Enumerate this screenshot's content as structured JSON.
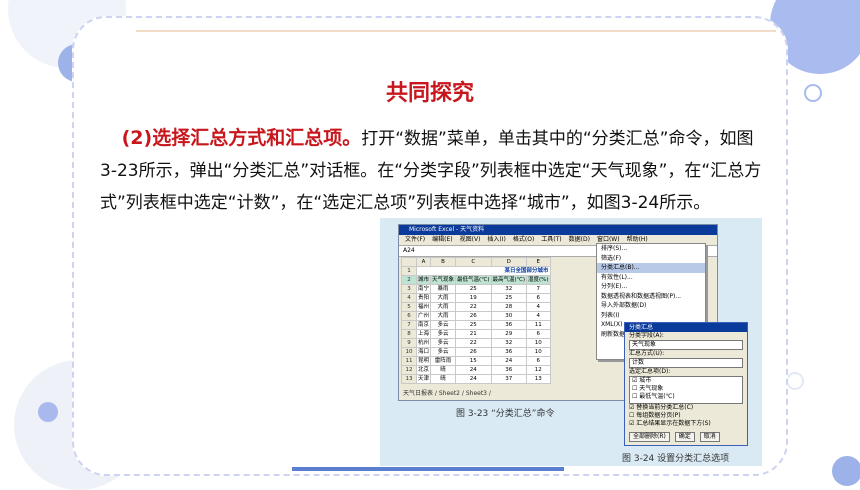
{
  "slide": {
    "title": "共同探究",
    "para_highlight": "(2)选择汇总方式和汇总项。",
    "para_text": "打开“数据”菜单，单击其中的“分类汇总”命令，如图3-23所示，弹出“分类汇总”对话框。在“分类字段”列表框中选定“天气现象”，在“汇总方式”列表框中选定“计数”，在“选定汇总项”列表框中选择“城市”，如图3-24所示。"
  },
  "excel": {
    "window_title": "Microsoft Excel - 天气资料",
    "menu": [
      "文件(F)",
      "编辑(E)",
      "视图(V)",
      "插入(I)",
      "格式(O)",
      "工具(T)",
      "数据(D)",
      "窗口(W)",
      "帮助(H)"
    ],
    "name_box": "A24",
    "col_headers": [
      "",
      "A",
      "B",
      "C",
      "D",
      "E"
    ],
    "sheet_title": "某日全国部分城市",
    "table_header": [
      "城市",
      "天气现象",
      "最低气温(℃)",
      "最高气温(℃)",
      "湿度(%)"
    ],
    "rows": [
      [
        "3",
        "南宁",
        "暴雨",
        "25",
        "32",
        "7"
      ],
      [
        "4",
        "贵阳",
        "大雨",
        "19",
        "25",
        "6"
      ],
      [
        "5",
        "福州",
        "大雨",
        "22",
        "28",
        "4"
      ],
      [
        "6",
        "广州",
        "大雨",
        "26",
        "30",
        "4"
      ],
      [
        "7",
        "南京",
        "多云",
        "25",
        "36",
        "11"
      ],
      [
        "8",
        "上海",
        "多云",
        "21",
        "29",
        "6"
      ],
      [
        "9",
        "杭州",
        "多云",
        "22",
        "32",
        "10"
      ],
      [
        "10",
        "海口",
        "多云",
        "26",
        "36",
        "10"
      ],
      [
        "11",
        "昆明",
        "雷阵雨",
        "15",
        "24",
        "6"
      ],
      [
        "12",
        "北京",
        "晴",
        "24",
        "36",
        "12"
      ],
      [
        "13",
        "天津",
        "晴",
        "24",
        "37",
        "13"
      ]
    ],
    "sheet_tabs": "天气日报表 / Sheet2 / Sheet3 /",
    "dropdown": [
      "排序(S)...",
      "筛选(F)",
      "分类汇总(B)...",
      "有效性(L)...",
      "分列(E)...",
      "数据透视表和数据透视图(P)...",
      "导入外部数据(D)",
      "列表(I)",
      "XML(X)",
      "刷新数据(R)"
    ],
    "dropdown_selected": 2
  },
  "dialog": {
    "title": "分类汇总",
    "field_label": "分类字段(A):",
    "field_value": "天气现象",
    "method_label": "汇总方式(U):",
    "method_value": "计数",
    "items_label": "选定汇总项(D):",
    "items": [
      "☑ 城市",
      "☐ 天气现象",
      "☐ 最低气温(℃)"
    ],
    "check1": "☑ 替换当前分类汇总(C)",
    "check2": "☐ 每组数据分页(P)",
    "check3": "☑ 汇总结果显示在数据下方(S)",
    "btn_remove": "全部删除(R)",
    "btn_ok": "确定",
    "btn_cancel": "取消"
  },
  "captions": {
    "fig23": "图 3-23    “分类汇总”命令",
    "fig24": "图 3-24    设置分类汇总选项"
  }
}
